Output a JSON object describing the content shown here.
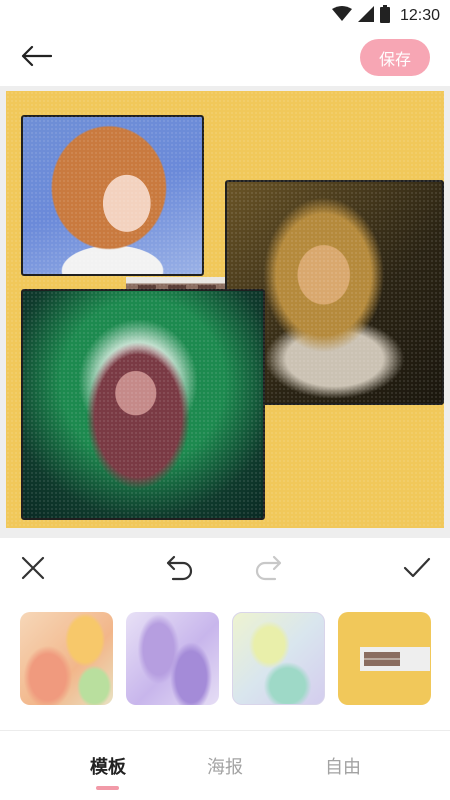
{
  "status_bar": {
    "time": "12:30",
    "icons": [
      "wifi-icon",
      "cellular-signal-icon",
      "battery-icon"
    ]
  },
  "header": {
    "back_icon": "arrow-left-icon",
    "save_label": "保存",
    "save_color": "#f7a6b4"
  },
  "canvas": {
    "background_color": "#f1c85a",
    "photos": [
      "photo-portrait-1",
      "photo-portrait-2",
      "photo-portrait-3"
    ]
  },
  "edit_toolbar": {
    "icons": [
      "close-icon",
      "undo-icon",
      "redo-icon",
      "check-icon"
    ],
    "redo_enabled": false
  },
  "templates": {
    "items": [
      "template-watercolor-orange",
      "template-watercolor-purple",
      "template-watercolor-pastel",
      "template-yellow-collage"
    ]
  },
  "tabs": {
    "items": [
      {
        "label": "模板",
        "active": true
      },
      {
        "label": "海报",
        "active": false
      },
      {
        "label": "自由",
        "active": false
      }
    ],
    "indicator_color": "#f29aa8"
  }
}
